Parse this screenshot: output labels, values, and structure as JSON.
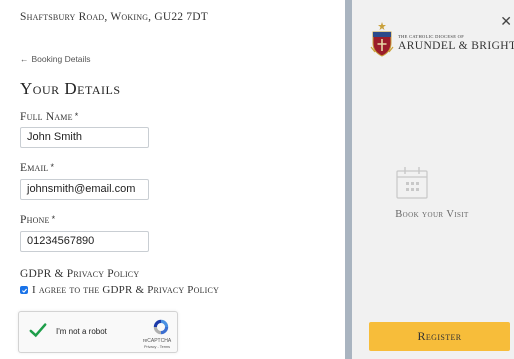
{
  "header": {
    "address": "Shaftsbury Road, Woking, GU22 7DT"
  },
  "nav": {
    "back_label": "Booking Details"
  },
  "form": {
    "title": "Your Details",
    "full_name": {
      "label": "Full Name",
      "required": "*",
      "value": "John Smith"
    },
    "email": {
      "label": "Email",
      "required": "*",
      "value": "johnsmith@email.com"
    },
    "phone": {
      "label": "Phone",
      "required": "*",
      "value": "01234567890"
    },
    "gdpr": {
      "heading": "GDPR & Privacy Policy",
      "checkbox_label": "I agree to the GDPR & Privacy Policy",
      "checked": true
    },
    "recaptcha": {
      "label": "I'm not a robot",
      "brand": "reCAPTCHA",
      "links": "Privacy - Terms",
      "checked": true
    }
  },
  "panel": {
    "logo_small": "THE CATHOLIC DIOCESE OF",
    "logo_big": "ARUNDEL & BRIGHTON",
    "close_icon": "close-icon",
    "calendar_icon": "calendar-icon",
    "visit_label": "Book your Visit",
    "register_label": "Register"
  },
  "colors": {
    "accent": "#f7bd3a",
    "panel_bg": "#f1f1f1",
    "panel_bar": "#a9b4c0",
    "check": "#1a73e8"
  }
}
